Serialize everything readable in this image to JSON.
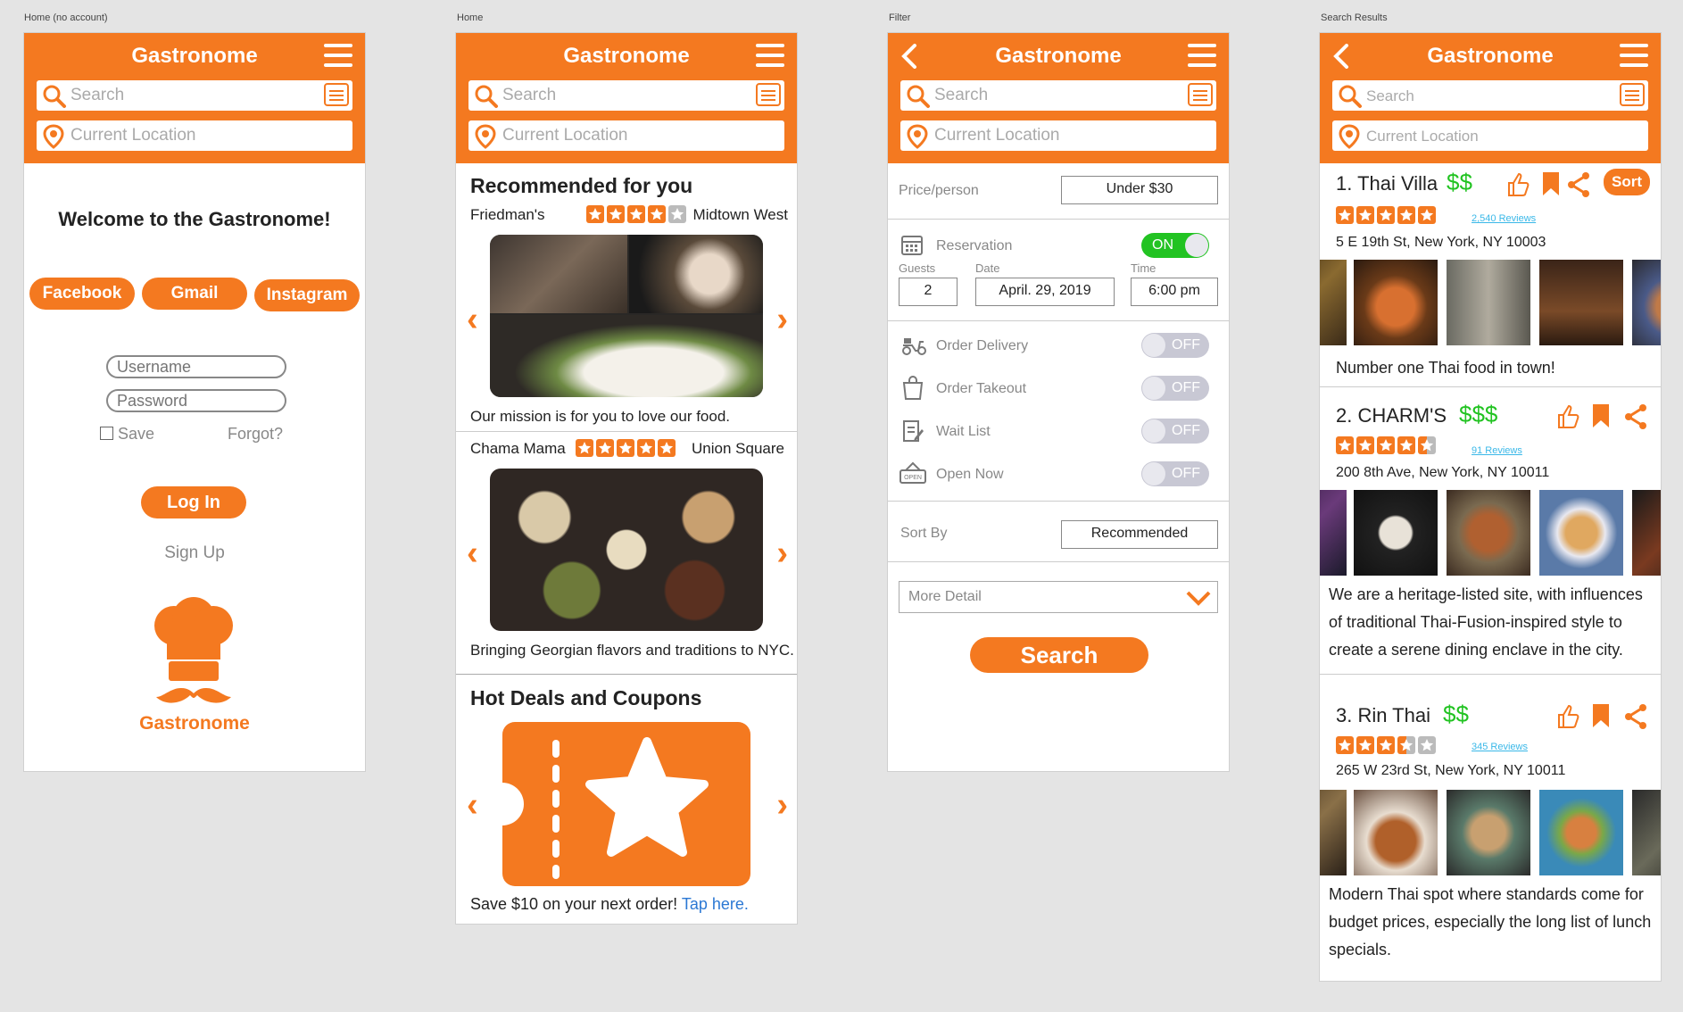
{
  "app_name": "Gastronome",
  "accent_color": "#f47920",
  "frames": {
    "f1": "Home (no account)",
    "f2": "Home",
    "f3": "Filter",
    "f4": "Search Results"
  },
  "header": {
    "search_placeholder": "Search",
    "location_placeholder": "Current Location"
  },
  "login": {
    "welcome": "Welcome to the Gastronome!",
    "facebook": "Facebook",
    "gmail": "Gmail",
    "instagram": "Instagram",
    "username_placeholder": "Username",
    "password_placeholder": "Password",
    "save": "Save",
    "forgot": "Forgot?",
    "login": "Log In",
    "signup": "Sign Up",
    "logo_text": "Gastronome"
  },
  "home": {
    "recommended_title": "Recommended for you",
    "items": [
      {
        "name": "Friedman's",
        "rating": 4,
        "area": "Midtown West",
        "caption": "Our mission is for you to love our food."
      },
      {
        "name": "Chama Mama",
        "rating": 5,
        "area": "Union Square",
        "caption": "Bringing Georgian flavors and traditions to NYC."
      }
    ],
    "deals_title": "Hot Deals and Coupons",
    "deal_text": "Save $10 on your next order!",
    "deal_link": "Tap here."
  },
  "filter": {
    "price_label": "Price/person",
    "price_value": "Under $30",
    "reservation_label": "Reservation",
    "reservation_state": "ON",
    "guests_label": "Guests",
    "guests_value": "2",
    "date_label": "Date",
    "date_value": "April. 29, 2019",
    "time_label": "Time",
    "time_value": "6:00 pm",
    "delivery_label": "Order Delivery",
    "takeout_label": "Order Takeout",
    "waitlist_label": "Wait List",
    "opennow_label": "Open Now",
    "off_label": "OFF",
    "sortby_label": "Sort By",
    "sortby_value": "Recommended",
    "more_detail": "More Detail",
    "search_button": "Search"
  },
  "results": {
    "sort_button": "Sort",
    "items": [
      {
        "title": "1. Thai Villa",
        "price": "$$",
        "rating": 5,
        "reviews": "2,540 Reviews",
        "address": "5 E 19th St, New York, NY 10003",
        "description": "Number one Thai food in town!"
      },
      {
        "title": "2. CHARM'S",
        "price": "$$$",
        "rating": 4.5,
        "reviews": "91 Reviews",
        "address": "200 8th Ave, New York, NY 10011",
        "description": "We are a heritage-listed site, with influences of traditional Thai-Fusion-inspired style to create a serene dining enclave in the city."
      },
      {
        "title": "3. Rin Thai",
        "price": "$$",
        "rating": 3.5,
        "reviews": "345 Reviews",
        "address": "265 W 23rd St, New York, NY 10011",
        "description": "Modern Thai spot where standards come for budget prices, especially the long list of lunch specials."
      }
    ]
  }
}
